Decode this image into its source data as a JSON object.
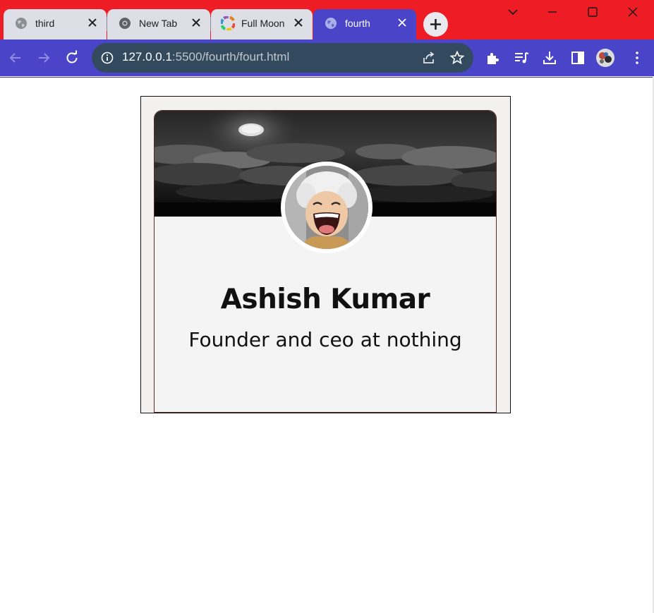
{
  "browser": {
    "tabs": [
      {
        "title": "third",
        "favicon": "globe-icon",
        "active": false
      },
      {
        "title": "New Tab",
        "favicon": "chrome-icon",
        "active": false
      },
      {
        "title": "Full Moon",
        "favicon": "color-wheel-icon",
        "active": false
      },
      {
        "title": "fourth",
        "favicon": "globe-icon",
        "active": true
      }
    ],
    "address": {
      "host": "127.0.0.1",
      "path": ":5500/fourth/fourt.html"
    },
    "colors": {
      "tabstrip": "#ee1c25",
      "toolbar": "#4a44c8",
      "omnibox": "#334a5e"
    }
  },
  "profile_card": {
    "name": "Ashish Kumar",
    "role": "Founder and ceo at nothing",
    "banner": "moon-night-clouds-image",
    "avatar": "cartoon-avatar-image"
  }
}
